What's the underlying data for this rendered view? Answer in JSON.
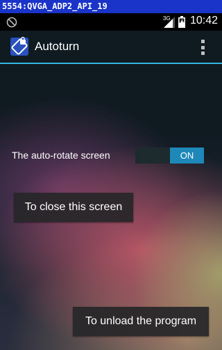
{
  "emulator": {
    "title": "5554:QVGA_ADP2_API_19"
  },
  "status_bar": {
    "left_icon": "no-sync-icon",
    "network_type": "3G",
    "time": "10:42"
  },
  "action_bar": {
    "title": "Autoturn",
    "app_icon": "autorotate-lock-icon",
    "overflow_icon": "overflow-menu-icon",
    "accent_color": "#33b5e5"
  },
  "settings": {
    "auto_rotate": {
      "label": "The auto-rotate screen",
      "state": "ON"
    }
  },
  "buttons": {
    "close_screen": "To close this screen",
    "unload_program": "To unload the program"
  }
}
